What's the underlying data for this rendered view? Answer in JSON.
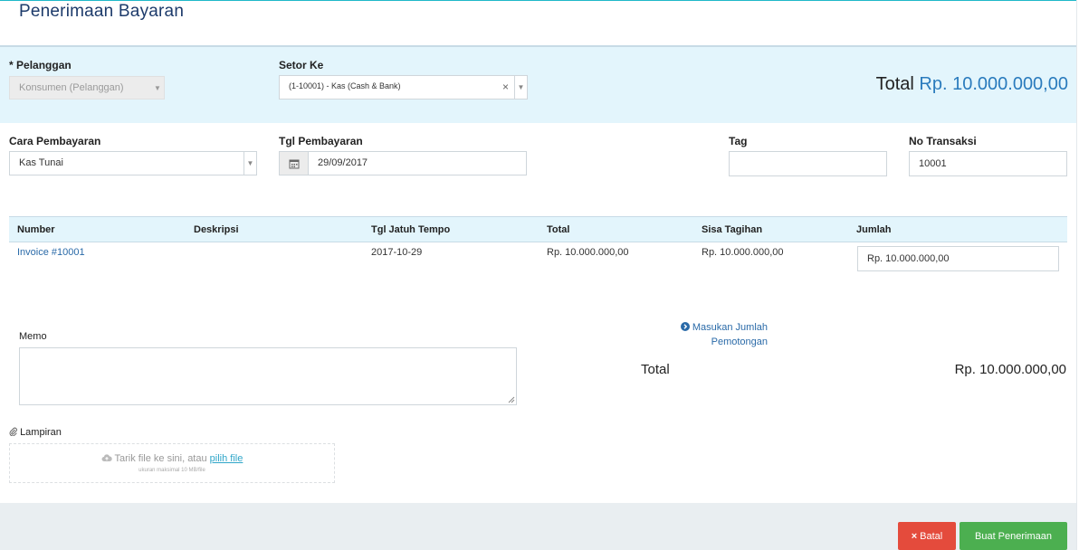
{
  "page": {
    "title": "Penerimaan Bayaran"
  },
  "customer": {
    "label": "Pelanggan",
    "required_mark": "*",
    "value": "Konsumen (Pelanggan)"
  },
  "deposit_to": {
    "label": "Setor Ke",
    "value": "(1-10001) - Kas (Cash & Bank)",
    "clear": "×"
  },
  "summary_top": {
    "label": "Total",
    "amount": "Rp. 10.000.000,00"
  },
  "payment_method": {
    "label": "Cara Pembayaran",
    "value": "Kas Tunai"
  },
  "payment_date": {
    "label": "Tgl Pembayaran",
    "value": "29/09/2017"
  },
  "tag": {
    "label": "Tag",
    "value": ""
  },
  "transaction_no": {
    "label": "No Transaksi",
    "value": "10001"
  },
  "table": {
    "headers": [
      "Number",
      "Deskripsi",
      "Tgl Jatuh Tempo",
      "Total",
      "Sisa Tagihan",
      "Jumlah"
    ],
    "rows": [
      {
        "number": "Invoice #10001",
        "description": "",
        "due_date": "2017-10-29",
        "total": "Rp. 10.000.000,00",
        "remaining": "Rp. 10.000.000,00",
        "amount": "Rp. 10.000.000,00"
      }
    ]
  },
  "memo": {
    "label": "Memo",
    "value": ""
  },
  "discount_link": {
    "line1": "Masukan Jumlah",
    "line2": "Pemotongan"
  },
  "summary_bottom": {
    "label": "Total",
    "amount": "Rp. 10.000.000,00"
  },
  "attachment": {
    "label": "Lampiran",
    "drop_text": "Tarik file ke sini, atau",
    "pick_link": "pilih file",
    "size_hint": "ukuran maksimal 10 MB/file"
  },
  "actions": {
    "cancel_label": "Batal",
    "cancel_icon": "×",
    "submit_label": "Buat Penerimaan"
  },
  "colors": {
    "accent": "#2a7bbd",
    "band": "#e3f5fc",
    "cancel": "#e44b3c",
    "submit": "#4caf50"
  }
}
